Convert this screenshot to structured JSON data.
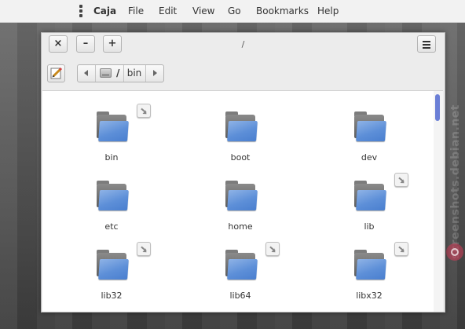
{
  "menubar": {
    "app_name": "Caja",
    "items": [
      "File",
      "Edit",
      "View",
      "Go",
      "Bookmarks",
      "Help"
    ]
  },
  "window": {
    "title": "/",
    "controls": {
      "close": "×",
      "minimize": "–",
      "maximize": "+"
    }
  },
  "pathbar": {
    "root": "/",
    "current": "bin"
  },
  "files": [
    {
      "name": "bin",
      "symlink": true
    },
    {
      "name": "boot",
      "symlink": false
    },
    {
      "name": "dev",
      "symlink": false
    },
    {
      "name": "etc",
      "symlink": false
    },
    {
      "name": "home",
      "symlink": false
    },
    {
      "name": "lib",
      "symlink": true
    },
    {
      "name": "lib32",
      "symlink": true
    },
    {
      "name": "lib64",
      "symlink": true
    },
    {
      "name": "libx32",
      "symlink": true
    }
  ],
  "watermark": "screenshots.debian.net",
  "colors": {
    "folder_front": "#5d8fd8",
    "scrollbar": "#6b7fd6"
  }
}
